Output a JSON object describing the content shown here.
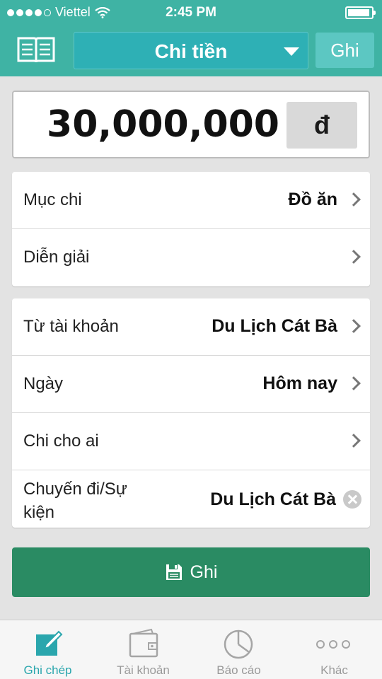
{
  "status_bar": {
    "carrier": "Viettel",
    "time": "2:45 PM"
  },
  "header": {
    "title": "Chi tiền",
    "save_label": "Ghi",
    "icons": {
      "book": "book-icon",
      "dropdown": "caret-down-icon"
    }
  },
  "amount": {
    "value": "30,000,000",
    "currency": "đ"
  },
  "section1": {
    "rows": [
      {
        "label": "Mục chi",
        "value": "Đồ ăn"
      },
      {
        "label": "Diễn giải",
        "value": ""
      }
    ]
  },
  "section2": {
    "rows": [
      {
        "label": "Từ tài khoản",
        "value": "Du Lịch Cát Bà"
      },
      {
        "label": "Ngày",
        "value": "Hôm nay"
      },
      {
        "label": "Chi cho ai",
        "value": ""
      },
      {
        "label": "Chuyến đi/Sự kiện",
        "value": "Du Lịch Cát Bà"
      }
    ]
  },
  "save_button": {
    "label": "Ghi",
    "icon": "floppy-disk-icon"
  },
  "tabbar": {
    "tabs": [
      {
        "label": "Ghi chép",
        "icon": "pencil-note-icon",
        "active": true
      },
      {
        "label": "Tài khoản",
        "icon": "wallet-icon",
        "active": false
      },
      {
        "label": "Báo cáo",
        "icon": "pie-chart-icon",
        "active": false
      },
      {
        "label": "Khác",
        "icon": "more-dots-icon",
        "active": false
      }
    ]
  },
  "colors": {
    "header_bg": "#3fb3a4",
    "dropdown_bg": "#2eb0b5",
    "save_button_bg": "#2a8b63",
    "active_tab": "#2aa6ad",
    "background": "#e3e3e3"
  }
}
